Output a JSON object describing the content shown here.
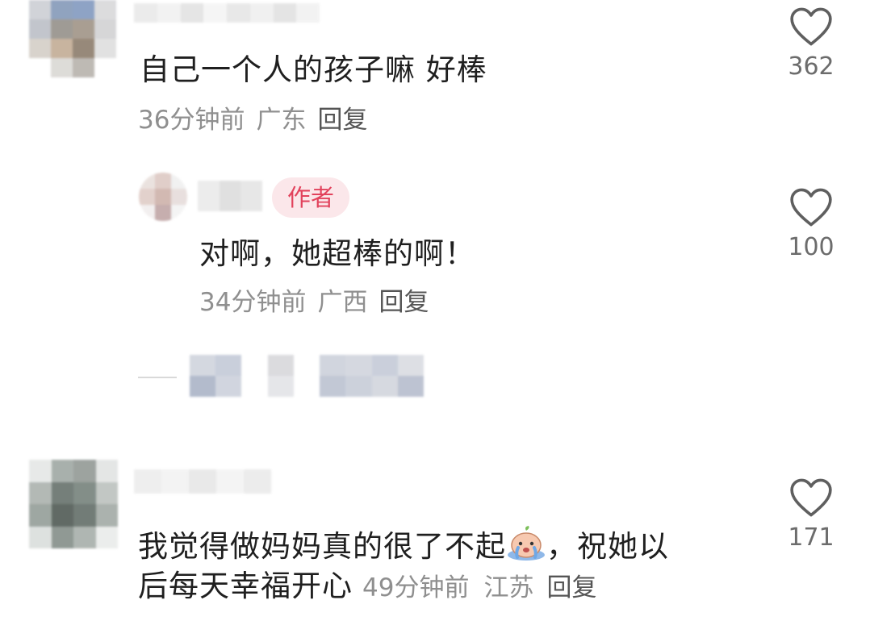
{
  "comments": [
    {
      "text": "自己一个人的孩子嘛 好棒",
      "time": "36分钟前",
      "location": "广东",
      "reply_label": "回复",
      "like_count": "362"
    },
    {
      "text": "对啊，她超棒的啊！",
      "time": "34分钟前",
      "location": "广西",
      "reply_label": "回复",
      "like_count": "100",
      "badge": "作者"
    },
    {
      "text_line1": "我觉得做妈妈真的很了不起",
      "text_line1_end": "，祝她以",
      "text_line2": "后每天幸福开心",
      "emoji": "crying-face-emoji",
      "time": "49分钟前",
      "location": "江苏",
      "reply_label": "回复",
      "like_count": "171"
    }
  ],
  "icons": {
    "like": "heart-outline-icon"
  },
  "colors": {
    "badge_bg": "#fbe7ea",
    "badge_text": "#e2425c",
    "meta_text": "#8f8f8f"
  }
}
